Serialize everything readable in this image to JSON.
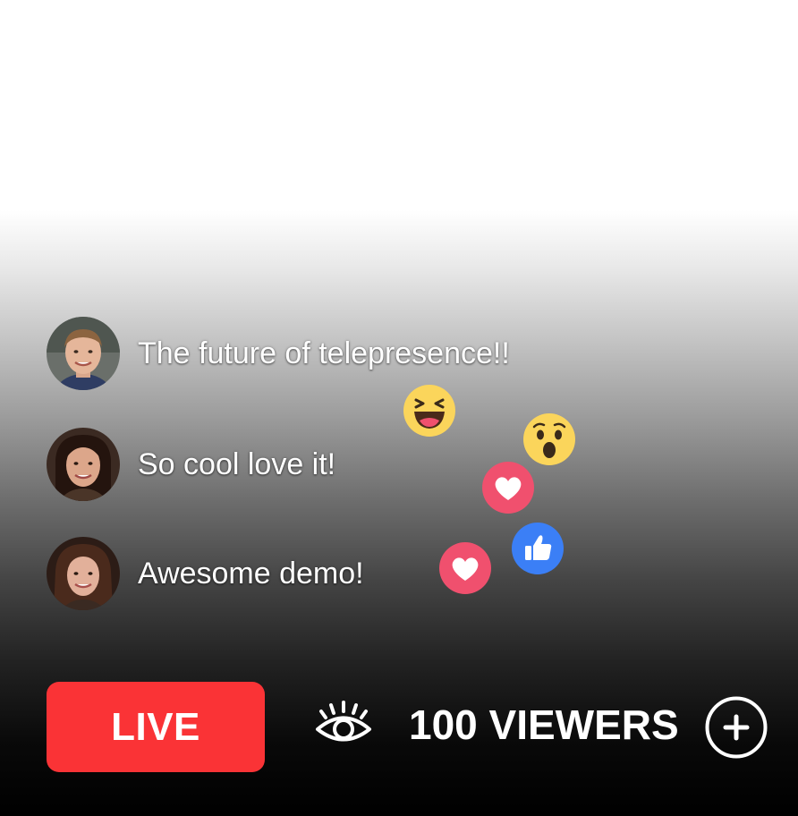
{
  "comments": [
    {
      "text": "The future of telepresence!!",
      "avatar_icon": "avatar-man-short-hair"
    },
    {
      "text": "So cool love it!",
      "avatar_icon": "avatar-woman-dark-hair"
    },
    {
      "text": "Awesome demo!",
      "avatar_icon": "avatar-woman-brown-hair"
    }
  ],
  "reactions": [
    {
      "icon": "haha-reaction-icon"
    },
    {
      "icon": "wow-reaction-icon"
    },
    {
      "icon": "love-reaction-icon"
    },
    {
      "icon": "like-reaction-icon"
    },
    {
      "icon": "love-reaction-icon"
    }
  ],
  "footer": {
    "live_label": "LIVE",
    "viewers_label": "100 VIEWERS",
    "viewers_icon": "eye-icon",
    "add_icon": "plus-circle-icon"
  },
  "colors": {
    "live_red": "#fa3336",
    "love_red": "#f0506e",
    "like_blue": "#3b7ff6",
    "emoji_yellow": "#fbd55b",
    "text": "#ffffff"
  }
}
